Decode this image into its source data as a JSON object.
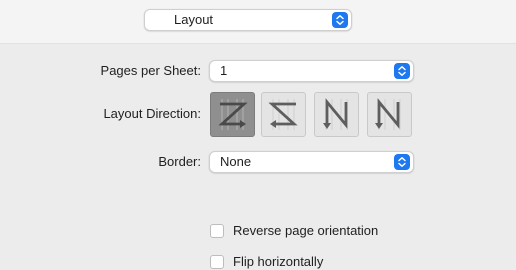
{
  "top_menu": {
    "value": "Layout"
  },
  "pages_per_sheet": {
    "label": "Pages per Sheet:",
    "value": "1"
  },
  "layout_direction": {
    "label": "Layout Direction:",
    "options": [
      {
        "name": "z-layout",
        "selected": true
      },
      {
        "name": "reverse-z-layout",
        "selected": false
      },
      {
        "name": "n-reverse-layout",
        "selected": false
      },
      {
        "name": "n-layout",
        "selected": false
      }
    ]
  },
  "border": {
    "label": "Border:",
    "value": "None"
  },
  "checkboxes": {
    "reverse_orientation": {
      "label": "Reverse page orientation",
      "checked": false
    },
    "flip_horizontally": {
      "label": "Flip horizontally",
      "checked": false
    }
  },
  "colors": {
    "accent": "#1e78f0",
    "selected_tile": "#8f8f8f",
    "tile": "#e4e4e4"
  }
}
